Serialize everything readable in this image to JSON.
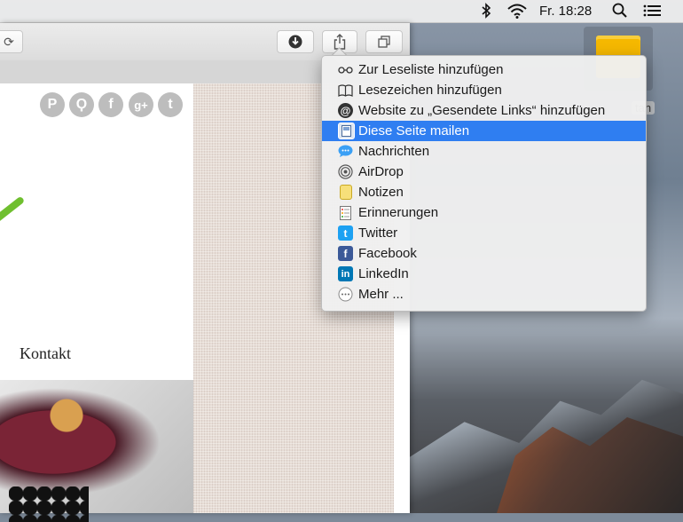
{
  "menubar": {
    "clock": "Fr. 18:28"
  },
  "desktop": {
    "folder_label": "tan"
  },
  "page": {
    "contact_link": "Kontakt",
    "social": [
      "P",
      "Ϙ",
      "f",
      "g+",
      "t"
    ]
  },
  "share_menu": {
    "items": [
      {
        "label": "Zur Leseliste hinzufügen",
        "icon": "glasses-icon"
      },
      {
        "label": "Lesezeichen hinzufügen",
        "icon": "book-icon"
      },
      {
        "label": "Website zu „Gesendete Links“ hinzufügen",
        "icon": "at-icon"
      },
      {
        "label": "Diese Seite mailen",
        "icon": "mail-icon"
      },
      {
        "label": "Nachrichten",
        "icon": "messages-icon"
      },
      {
        "label": "AirDrop",
        "icon": "airdrop-icon"
      },
      {
        "label": "Notizen",
        "icon": "notes-icon"
      },
      {
        "label": "Erinnerungen",
        "icon": "reminders-icon"
      },
      {
        "label": "Twitter",
        "icon": "twitter-icon"
      },
      {
        "label": "Facebook",
        "icon": "facebook-icon"
      },
      {
        "label": "LinkedIn",
        "icon": "linkedin-icon"
      },
      {
        "label": "Mehr ...",
        "icon": "more-icon"
      }
    ],
    "highlighted_index": 3
  },
  "colors": {
    "highlight": "#2f7ef1",
    "twitter": "#1da1f2",
    "facebook": "#3b5998",
    "linkedin": "#0077b5"
  }
}
